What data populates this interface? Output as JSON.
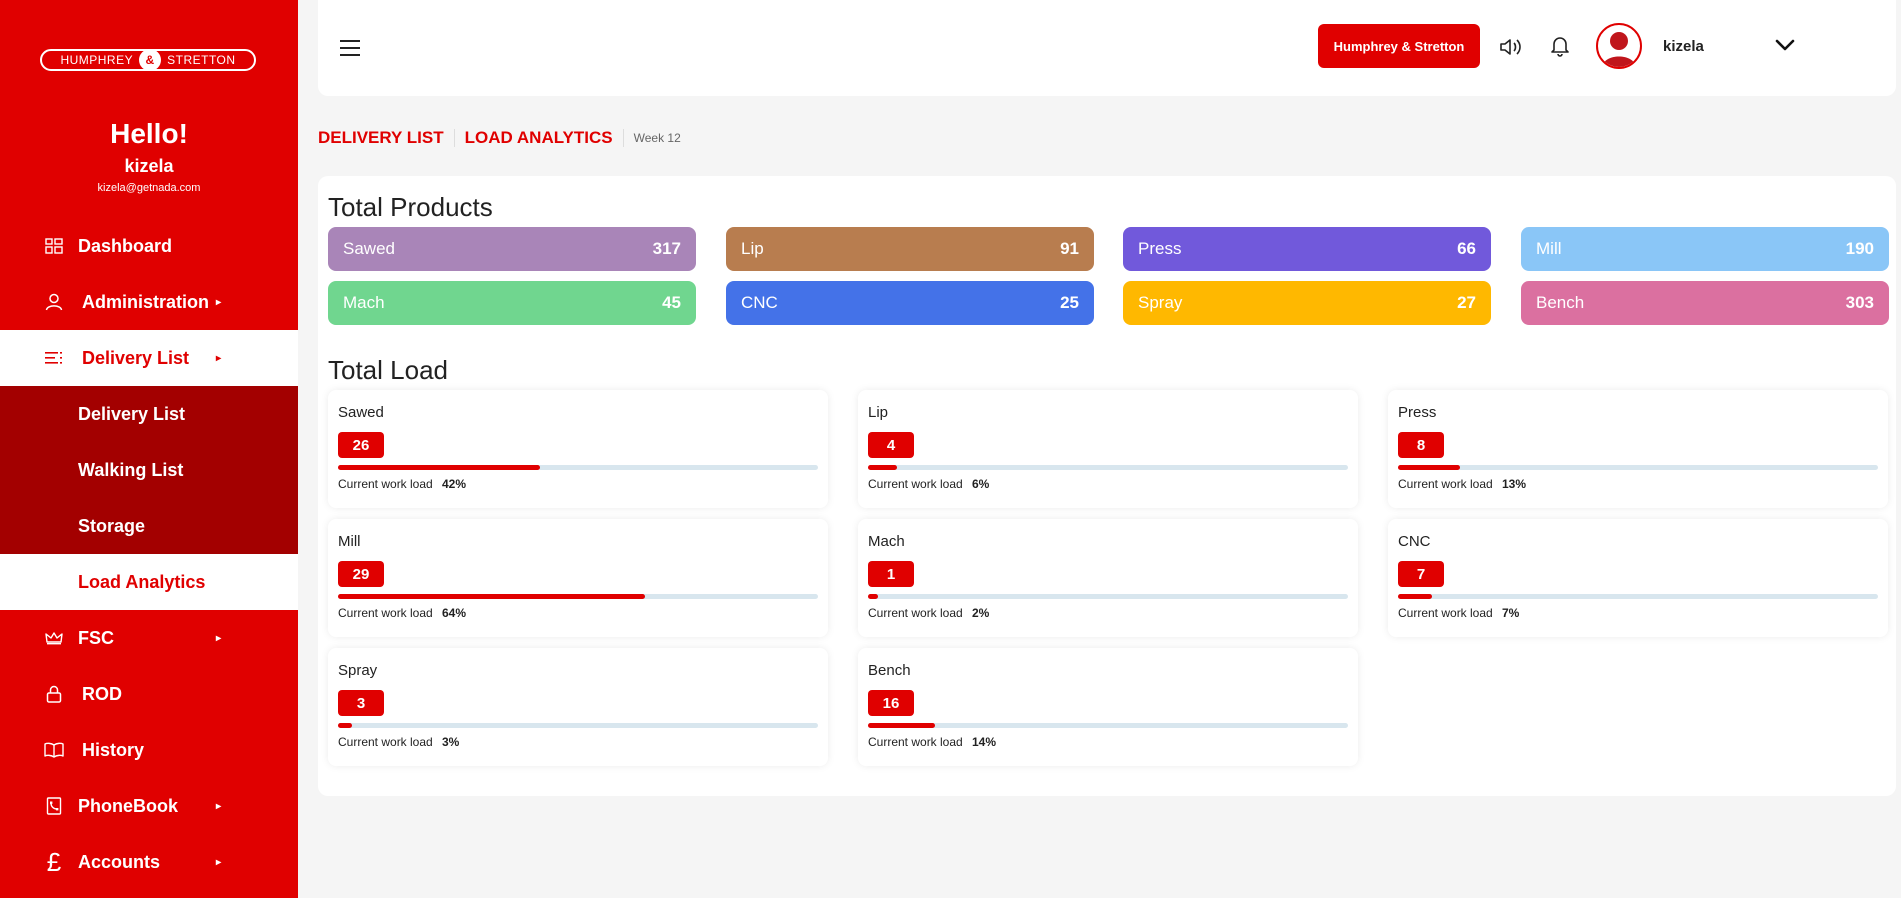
{
  "sidebar": {
    "logo": {
      "left": "HUMPHREY",
      "amp": "&",
      "right": "STRETTON"
    },
    "hello": "Hello!",
    "username": "kizela",
    "email": "kizela@getnada.com",
    "items": [
      {
        "label": "Dashboard",
        "icon": "grid-icon"
      },
      {
        "label": "Administration",
        "icon": "user-icon"
      },
      {
        "label": "Delivery List",
        "icon": "list-icon"
      },
      {
        "label": "FSC",
        "icon": "crown-icon"
      },
      {
        "label": "ROD",
        "icon": "lock-icon"
      },
      {
        "label": "History",
        "icon": "book-icon"
      },
      {
        "label": "PhoneBook",
        "icon": "phonebook-icon"
      },
      {
        "label": "Accounts",
        "icon": "pound-icon"
      }
    ],
    "submenu": [
      "Delivery List",
      "Walking List",
      "Storage",
      "Load Analytics"
    ]
  },
  "header": {
    "brand_button": "Humphrey & Stretton",
    "username": "kizela"
  },
  "breadcrumb": {
    "first": "DELIVERY LIST",
    "second": "LOAD ANALYTICS",
    "week": "Week 12"
  },
  "total_products": {
    "title": "Total Products",
    "items": [
      {
        "name": "Sawed",
        "value": "317",
        "color": "#a985b8"
      },
      {
        "name": "Lip",
        "value": "91",
        "color": "#b87d4f"
      },
      {
        "name": "Press",
        "value": "66",
        "color": "#7159db"
      },
      {
        "name": "Mill",
        "value": "190",
        "color": "#8ac6f7"
      },
      {
        "name": "Mach",
        "value": "45",
        "color": "#70d68f"
      },
      {
        "name": "CNC",
        "value": "25",
        "color": "#4472e8"
      },
      {
        "name": "Spray",
        "value": "27",
        "color": "#ffb800"
      },
      {
        "name": "Bench",
        "value": "303",
        "color": "#db70a0"
      }
    ]
  },
  "total_load": {
    "title": "Total Load",
    "workload_label": "Current work load",
    "items": [
      {
        "name": "Sawed",
        "count": "26",
        "percent": "42%",
        "level": 0.42
      },
      {
        "name": "Lip",
        "count": "4",
        "percent": "6%",
        "level": 0.06
      },
      {
        "name": "Press",
        "count": "8",
        "percent": "13%",
        "level": 0.13
      },
      {
        "name": "Mill",
        "count": "29",
        "percent": "64%",
        "level": 0.64
      },
      {
        "name": "Mach",
        "count": "1",
        "percent": "2%",
        "level": 0.02
      },
      {
        "name": "CNC",
        "count": "7",
        "percent": "7%",
        "level": 0.07
      },
      {
        "name": "Spray",
        "count": "3",
        "percent": "3%",
        "level": 0.03
      },
      {
        "name": "Bench",
        "count": "16",
        "percent": "14%",
        "level": 0.14
      }
    ]
  }
}
